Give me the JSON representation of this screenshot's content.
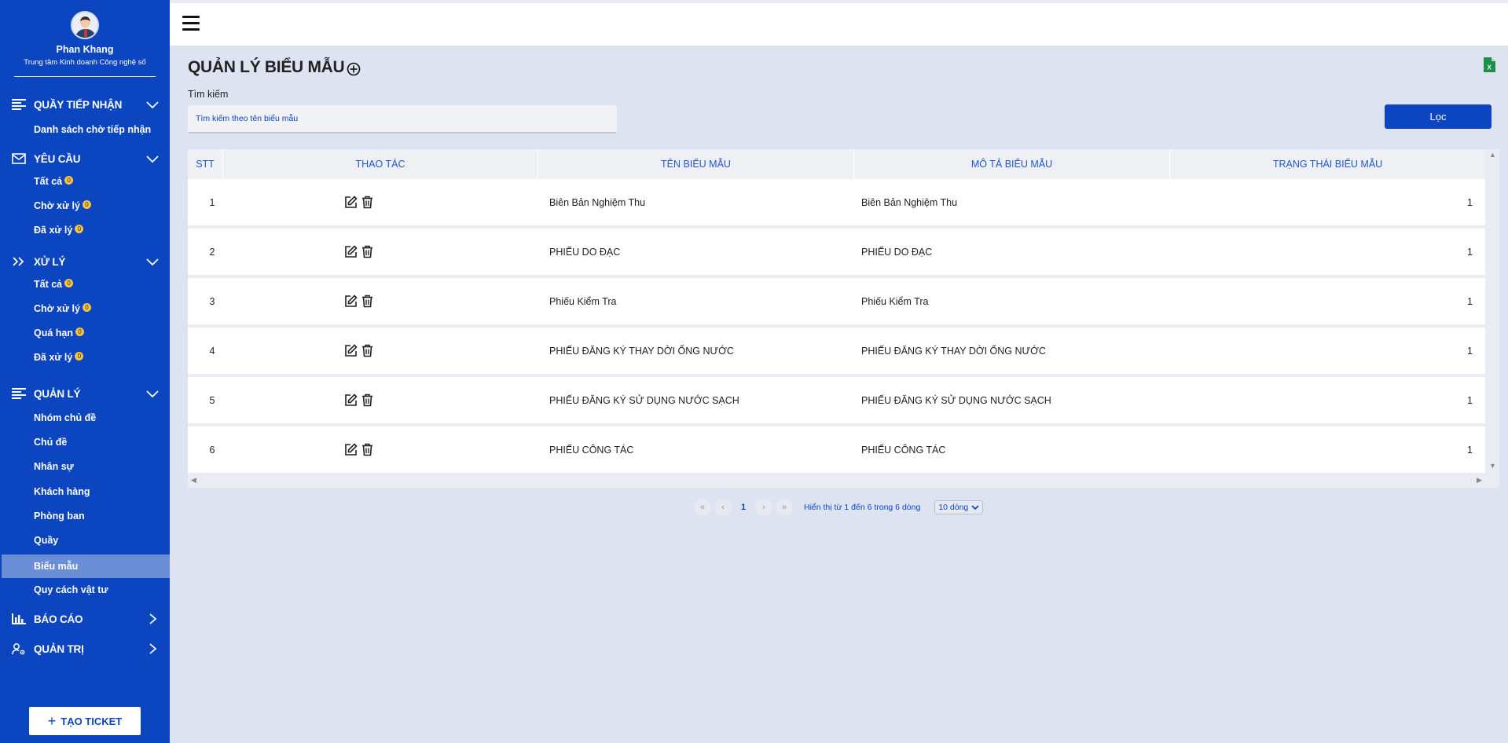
{
  "sidebar": {
    "profile": {
      "name": "Phan Khang",
      "org": "Trung tâm Kinh doanh Công nghệ số"
    },
    "sections": [
      {
        "label": "QUẦY TIẾP NHẬN",
        "icon": "list-icon",
        "items": [
          {
            "label": "Danh sách chờ tiếp nhận"
          }
        ]
      },
      {
        "label": "YÊU CẦU",
        "icon": "mail-icon",
        "items": [
          {
            "label": "Tất cả",
            "badge": "0"
          },
          {
            "label": "Chờ xử lý",
            "badge": "0"
          },
          {
            "label": "Đã xử lý",
            "badge": "0"
          }
        ]
      },
      {
        "label": "XỬ LÝ",
        "icon": "double-chevron-icon",
        "items": [
          {
            "label": "Tất cả",
            "badge": "0"
          },
          {
            "label": "Chờ xử lý",
            "badge": "0"
          },
          {
            "label": "Quá hạn",
            "badge": "0"
          },
          {
            "label": "Đã xử lý",
            "badge": "0"
          }
        ]
      },
      {
        "label": "QUẢN LÝ",
        "icon": "list-icon",
        "items": [
          {
            "label": "Nhóm chủ đề"
          },
          {
            "label": "Chủ đề"
          },
          {
            "label": "Nhân sự"
          },
          {
            "label": "Khách hàng"
          },
          {
            "label": "Phòng ban"
          },
          {
            "label": "Quầy"
          },
          {
            "label": "Biểu mẫu",
            "active": true
          },
          {
            "label": "Quy cách vật tư"
          }
        ]
      },
      {
        "label": "BÁO CÁO",
        "icon": "bar-chart-icon"
      },
      {
        "label": "QUẢN TRỊ",
        "icon": "user-gear-icon"
      }
    ],
    "create_ticket_label": "TẠO TICKET"
  },
  "main": {
    "title": "QUẢN LÝ BIỂU MẪU",
    "search": {
      "label": "Tìm kiếm",
      "placeholder": "Tìm kiếm theo tên biểu mẫu"
    },
    "filter_label": "Lọc",
    "table": {
      "columns": [
        "STT",
        "THAO TÁC",
        "TÊN BIỂU MẪU",
        "MÔ TẢ BIỂU MẪU",
        "TRẠNG THÁI BIỂU MẪU"
      ],
      "rows": [
        {
          "stt": "1",
          "name": "Biên Bản Nghiệm Thu",
          "desc": "Biên Bản Nghiệm Thu",
          "status": "1"
        },
        {
          "stt": "2",
          "name": "PHIẾU DO ĐẠC",
          "desc": "PHIẾU DO ĐẠC",
          "status": "1"
        },
        {
          "stt": "3",
          "name": "Phiếu Kiểm Tra",
          "desc": "Phiếu Kiểm Tra",
          "status": "1"
        },
        {
          "stt": "4",
          "name": "PHIẾU ĐĂNG KÝ THAY DỜI ỐNG NƯỚC",
          "desc": "PHIẾU ĐĂNG KÝ THAY DỜI ỐNG NƯỚC",
          "status": "1"
        },
        {
          "stt": "5",
          "name": "PHIẾU ĐĂNG KÝ SỬ DỤNG NƯỚC SẠCH",
          "desc": "PHIẾU ĐĂNG KÝ SỬ DỤNG NƯỚC SẠCH",
          "status": "1"
        },
        {
          "stt": "6",
          "name": "PHIẾU CÔNG TÁC",
          "desc": "PHIẾU CÔNG TÁC",
          "status": "1"
        }
      ]
    },
    "pagination": {
      "first": "«",
      "prev": "‹",
      "current": "1",
      "next": "›",
      "last": "»",
      "info": "Hiển thị từ 1 đến 6 trong 6 dòng",
      "page_size": "10 dòng"
    }
  }
}
